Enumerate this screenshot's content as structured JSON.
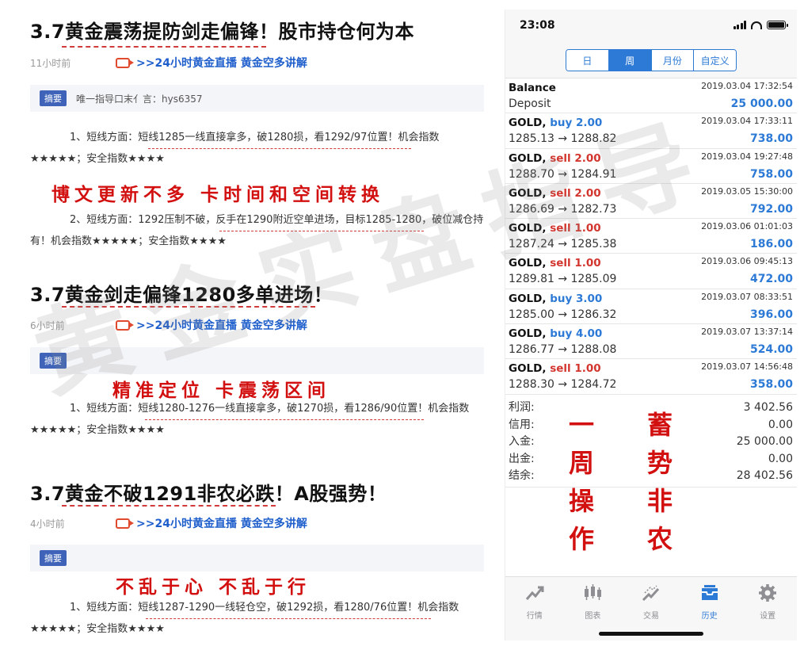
{
  "watermark": "黄金实盘指导",
  "articles": [
    {
      "title": "3.7黄金震荡提防剑走偏锋！股市持仓何为本",
      "time": "11小时前",
      "live_link": ">>24小时黄金直播 黄金空多讲解",
      "summary_label": "摘要",
      "summary": "唯一指导口末亻言：hys6357",
      "para1": "1、短线方面：短线1285一线直接拿多，破1280损，看1292/97位置！机会指数★★★★★；安全指数★★★★",
      "slogan": "博文更新不多  卡时间和空间转换",
      "para2": "2、短线方面：1292压制不破，反手在1290附近空单进场，目标1285-1280，破位减仓持有！机会指数★★★★★；安全指数★★★★"
    },
    {
      "title": "3.7黄金剑走偏锋1280多单进场！",
      "time": "6小时前",
      "live_link": ">>24小时黄金直播 黄金空多讲解",
      "summary_label": "摘要",
      "slogan": "精准定位  卡震荡区间",
      "para1": "1、短线方面：短线1280-1276一线直接拿多，破1270损，看1286/90位置！机会指数★★★★★；安全指数★★★★"
    },
    {
      "title": "3.7黄金不破1291非农必跌！A股强势！",
      "time": "4小时前",
      "live_link": ">>24小时黄金直播 黄金空多讲解",
      "summary_label": "摘要",
      "slogan": "不乱于心  不乱于行",
      "para1": "1、短线方面：短线1287-1290一线轻仓空，破1292损，看1280/76位置！机会指数★★★★★；安全指数★★★★"
    }
  ],
  "phone": {
    "status_time": "23:08",
    "battery_level": 1.0,
    "periods": [
      {
        "label": "日",
        "active": false
      },
      {
        "label": "周",
        "active": true
      },
      {
        "label": "月份",
        "active": false
      },
      {
        "label": "自定义",
        "active": false
      }
    ],
    "balance": {
      "label": "Balance",
      "datetime": "2019.03.04 17:32:54",
      "type": "Deposit",
      "amount": "25 000.00"
    },
    "deals": [
      {
        "symbol": "GOLD,",
        "side": "buy 2.00",
        "dir": "buy",
        "datetime": "2019.03.04 17:33:11",
        "prices": "1285.13 → 1288.82",
        "profit": "738.00"
      },
      {
        "symbol": "GOLD,",
        "side": "sell 2.00",
        "dir": "sell",
        "datetime": "2019.03.04 19:27:48",
        "prices": "1288.70 → 1284.91",
        "profit": "758.00"
      },
      {
        "symbol": "GOLD,",
        "side": "sell 2.00",
        "dir": "sell",
        "datetime": "2019.03.05 15:30:00",
        "prices": "1286.69 → 1282.73",
        "profit": "792.00"
      },
      {
        "symbol": "GOLD,",
        "side": "sell 1.00",
        "dir": "sell",
        "datetime": "2019.03.06 01:01:03",
        "prices": "1287.24 → 1285.38",
        "profit": "186.00"
      },
      {
        "symbol": "GOLD,",
        "side": "sell 1.00",
        "dir": "sell",
        "datetime": "2019.03.06 09:45:13",
        "prices": "1289.81 → 1285.09",
        "profit": "472.00"
      },
      {
        "symbol": "GOLD,",
        "side": "buy 3.00",
        "dir": "buy",
        "datetime": "2019.03.07 08:33:51",
        "prices": "1285.00 → 1286.32",
        "profit": "396.00"
      },
      {
        "symbol": "GOLD,",
        "side": "buy 4.00",
        "dir": "buy",
        "datetime": "2019.03.07 13:37:14",
        "prices": "1286.77 → 1288.08",
        "profit": "524.00"
      },
      {
        "symbol": "GOLD,",
        "side": "sell 1.00",
        "dir": "sell",
        "datetime": "2019.03.07 14:56:48",
        "prices": "1288.30 → 1284.72",
        "profit": "358.00"
      }
    ],
    "summary": [
      {
        "label": "利润:",
        "value": "3 402.56"
      },
      {
        "label": "信用:",
        "value": "0.00"
      },
      {
        "label": "入金:",
        "value": "25 000.00"
      },
      {
        "label": "出金:",
        "value": "0.00"
      },
      {
        "label": "结余:",
        "value": "28 402.56"
      }
    ],
    "callout_left": [
      "一",
      "周",
      "操",
      "作"
    ],
    "callout_right": [
      "蓄",
      "势",
      "非",
      "农"
    ],
    "tabs": [
      {
        "label": "行情",
        "icon": "quotes-icon",
        "active": false
      },
      {
        "label": "图表",
        "icon": "chart-icon",
        "active": false
      },
      {
        "label": "交易",
        "icon": "trade-icon",
        "active": false
      },
      {
        "label": "历史",
        "icon": "history-icon",
        "active": true
      },
      {
        "label": "设置",
        "icon": "settings-icon",
        "active": false
      }
    ],
    "colors": {
      "accent": "#2d7ad6",
      "sell": "#d2362f",
      "callout": "#d21010"
    }
  }
}
